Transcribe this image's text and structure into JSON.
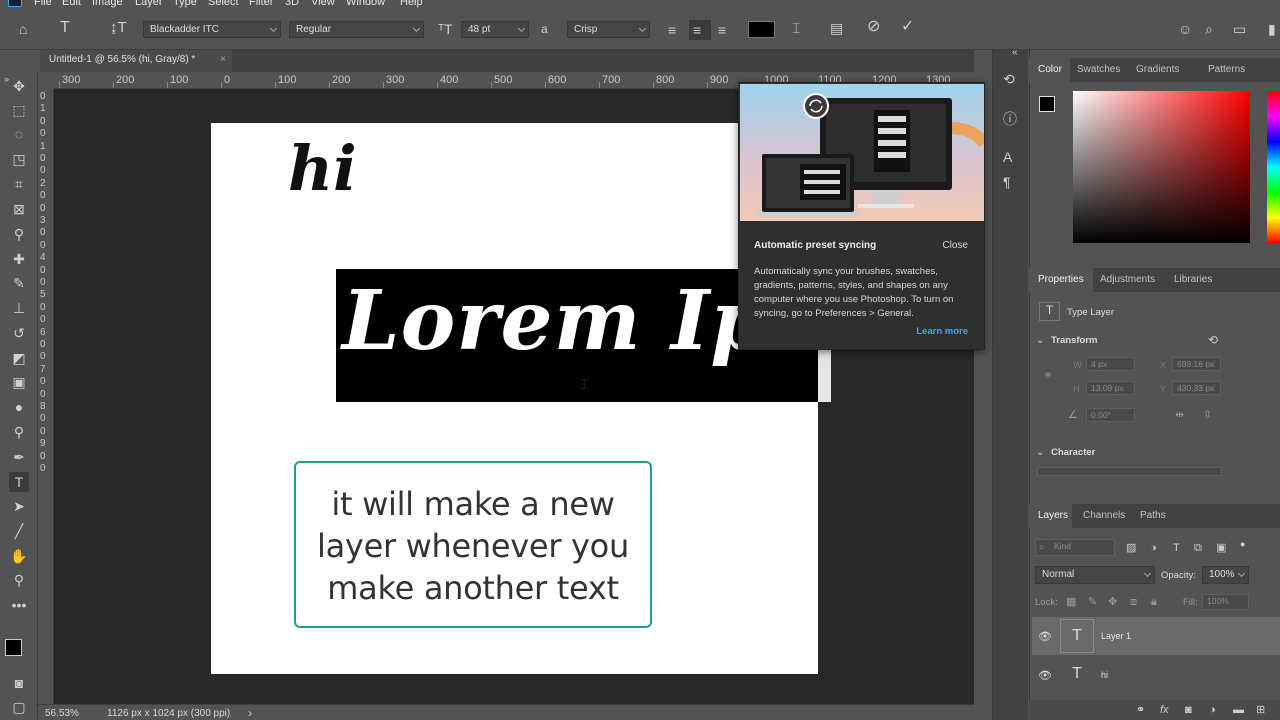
{
  "menu": [
    "File",
    "Edit",
    "Image",
    "Layer",
    "Type",
    "Select",
    "Filter",
    "3D",
    "View",
    "Window",
    "Help"
  ],
  "options": {
    "font_family": "Blackadder ITC",
    "font_style": "Regular",
    "font_size": "48 pt",
    "aa_label": "a",
    "antialias": "Crisp"
  },
  "document": {
    "tab_title": "Untitled-1 @ 56.5% (hi, Gray/8) *",
    "close": "×",
    "ruler_h": [
      "300",
      "200",
      "100",
      "0",
      "100",
      "200",
      "300",
      "400",
      "500",
      "600",
      "700",
      "800",
      "900",
      "1000",
      "1100",
      "1200",
      "1300"
    ],
    "ruler_v": [
      "0",
      "1",
      "0",
      "0",
      "1",
      "0",
      "0",
      "2",
      "0",
      "0",
      "3",
      "0",
      "0",
      "4",
      "0",
      "0",
      "5",
      "0",
      "0",
      "6",
      "0",
      "0",
      "7",
      "0",
      "0",
      "8",
      "0",
      "0",
      "9",
      "0",
      "0"
    ],
    "hi_text": "hi",
    "lorem_text": "Lorem Ipsum",
    "caption_lines": [
      "it will make a new",
      "layer whenever you",
      "make another text"
    ]
  },
  "status": {
    "zoom": "56.53%",
    "info": "1126 px x 1024 px (300 ppi)",
    "arrow": "›"
  },
  "popup": {
    "title": "Automatic preset syncing",
    "close": "Close",
    "body": "Automatically sync your brushes, swatches, gradients, patterns, styles, and shapes on any computer where you use Photoshop. To turn on syncing, go to Preferences > General.",
    "learn_more": "Learn more"
  },
  "color_panel": {
    "tabs": [
      "Color",
      "Swatches",
      "Gradients",
      "Patterns"
    ],
    "foreground": "#000000",
    "background": "#ffffff"
  },
  "properties": {
    "tabs": [
      "Properties",
      "Adjustments",
      "Libraries"
    ],
    "type_layer": "Type Layer",
    "transform": "Transform",
    "w_label": "W",
    "w": "4 px",
    "x_label": "X",
    "x": "689.16 px",
    "h_label": "H",
    "h": "13.09 px",
    "y_label": "Y",
    "y": "430.33 px",
    "angle": "0.00°",
    "character": "Character"
  },
  "layers_panel": {
    "tabs": [
      "Layers",
      "Channels",
      "Paths"
    ],
    "kind": "Kind",
    "blend": "Normal",
    "opacity_label": "Opacity:",
    "opacity": "100%",
    "lock_label": "Lock:",
    "fill_label": "Fill:",
    "fill": "100%",
    "layers": [
      {
        "name": "Layer 1",
        "thumb": "T"
      },
      {
        "name": "hi",
        "thumb": "T"
      }
    ]
  },
  "colors": {
    "accent": "#1f9d8f",
    "link": "#4ba3ff",
    "ps_blue": "#31a8ff"
  }
}
